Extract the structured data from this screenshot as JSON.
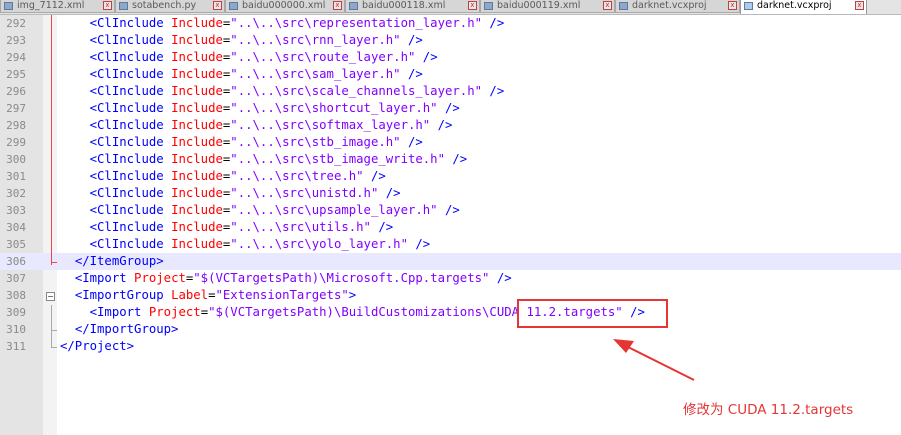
{
  "tabs": [
    {
      "label": "img_7112.xml"
    },
    {
      "label": "sotabench.py"
    },
    {
      "label": "baidu000000.xml"
    },
    {
      "label": "baidu000118.xml"
    },
    {
      "label": "baidu000119.xml"
    },
    {
      "label": "darknet.vcxproj"
    },
    {
      "label": "darknet.vcxproj",
      "active": true
    }
  ],
  "editor": {
    "current_line": "306",
    "lines": [
      {
        "num": "292",
        "indent": "    ",
        "tag": "<ClInclude ",
        "attr": "Include",
        "eq": "=",
        "val": "\"..\\..\\src\\representation_layer.h\"",
        "close": " />"
      },
      {
        "num": "293",
        "indent": "    ",
        "tag": "<ClInclude ",
        "attr": "Include",
        "eq": "=",
        "val": "\"..\\..\\src\\rnn_layer.h\"",
        "close": " />"
      },
      {
        "num": "294",
        "indent": "    ",
        "tag": "<ClInclude ",
        "attr": "Include",
        "eq": "=",
        "val": "\"..\\..\\src\\route_layer.h\"",
        "close": " />"
      },
      {
        "num": "295",
        "indent": "    ",
        "tag": "<ClInclude ",
        "attr": "Include",
        "eq": "=",
        "val": "\"..\\..\\src\\sam_layer.h\"",
        "close": " />"
      },
      {
        "num": "296",
        "indent": "    ",
        "tag": "<ClInclude ",
        "attr": "Include",
        "eq": "=",
        "val": "\"..\\..\\src\\scale_channels_layer.h\"",
        "close": " />"
      },
      {
        "num": "297",
        "indent": "    ",
        "tag": "<ClInclude ",
        "attr": "Include",
        "eq": "=",
        "val": "\"..\\..\\src\\shortcut_layer.h\"",
        "close": " />"
      },
      {
        "num": "298",
        "indent": "    ",
        "tag": "<ClInclude ",
        "attr": "Include",
        "eq": "=",
        "val": "\"..\\..\\src\\softmax_layer.h\"",
        "close": " />"
      },
      {
        "num": "299",
        "indent": "    ",
        "tag": "<ClInclude ",
        "attr": "Include",
        "eq": "=",
        "val": "\"..\\..\\src\\stb_image.h\"",
        "close": " />"
      },
      {
        "num": "300",
        "indent": "    ",
        "tag": "<ClInclude ",
        "attr": "Include",
        "eq": "=",
        "val": "\"..\\..\\src\\stb_image_write.h\"",
        "close": " />"
      },
      {
        "num": "301",
        "indent": "    ",
        "tag": "<ClInclude ",
        "attr": "Include",
        "eq": "=",
        "val": "\"..\\..\\src\\tree.h\"",
        "close": " />"
      },
      {
        "num": "302",
        "indent": "    ",
        "tag": "<ClInclude ",
        "attr": "Include",
        "eq": "=",
        "val": "\"..\\..\\src\\unistd.h\"",
        "close": " />"
      },
      {
        "num": "303",
        "indent": "    ",
        "tag": "<ClInclude ",
        "attr": "Include",
        "eq": "=",
        "val": "\"..\\..\\src\\upsample_layer.h\"",
        "close": " />"
      },
      {
        "num": "304",
        "indent": "    ",
        "tag": "<ClInclude ",
        "attr": "Include",
        "eq": "=",
        "val": "\"..\\..\\src\\utils.h\"",
        "close": " />"
      },
      {
        "num": "305",
        "indent": "    ",
        "tag": "<ClInclude ",
        "attr": "Include",
        "eq": "=",
        "val": "\"..\\..\\src\\yolo_layer.h\"",
        "close": " />"
      },
      {
        "num": "306",
        "indent": "  ",
        "tag": "</ItemGroup>",
        "attr": "",
        "eq": "",
        "val": "",
        "close": ""
      },
      {
        "num": "307",
        "indent": "  ",
        "tag": "<Import ",
        "attr": "Project",
        "eq": "=",
        "val": "\"$(VCTargetsPath)\\Microsoft.Cpp.targets\"",
        "close": " />"
      },
      {
        "num": "308",
        "indent": "  ",
        "tag": "<ImportGroup ",
        "attr": "Label",
        "eq": "=",
        "val": "\"ExtensionTargets\"",
        "close": ">"
      },
      {
        "num": "309",
        "indent": "    ",
        "tag": "<Import ",
        "attr": "Project",
        "eq": "=",
        "val": "\"$(VCTargetsPath)\\BuildCustomizations\\CUDA 11.2.targets\"",
        "close": " />"
      },
      {
        "num": "310",
        "indent": "  ",
        "tag": "</ImportGroup>",
        "attr": "",
        "eq": "",
        "val": "",
        "close": ""
      },
      {
        "num": "311",
        "indent": "",
        "tag": "</Project>",
        "attr": "",
        "eq": "",
        "val": "",
        "close": ""
      }
    ]
  },
  "annotation": {
    "text": "修改为 CUDA 11.2.targets",
    "color": "#e53535"
  },
  "colors": {
    "tag": "#0000ff",
    "attribute": "#ff0000",
    "value": "#8000ff",
    "current_line_bg": "#e8e8ff"
  }
}
